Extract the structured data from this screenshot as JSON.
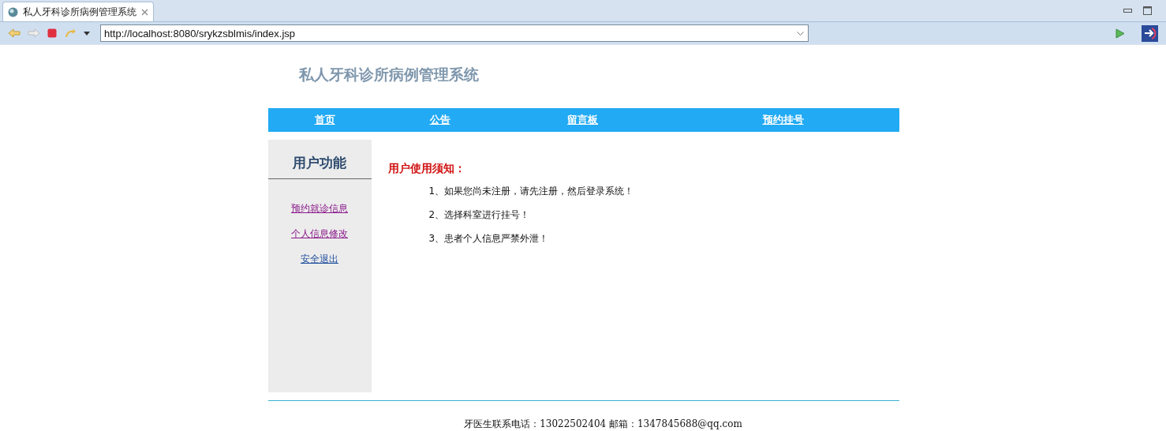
{
  "browser": {
    "tab_title": "私人牙科诊所病例管理系统",
    "url": "http://localhost:8080/srykzsblmis/index.jsp"
  },
  "site_title": "私人牙科诊所病例管理系统",
  "nav": [
    {
      "label": "首页"
    },
    {
      "label": "公告"
    },
    {
      "label": "留言板"
    },
    {
      "label": "预约挂号"
    }
  ],
  "sidebar": {
    "title": "用户功能",
    "links": [
      {
        "label": "预约就诊信息",
        "visited": true
      },
      {
        "label": "个人信息修改",
        "visited": true
      },
      {
        "label": "安全退出",
        "visited": false
      }
    ]
  },
  "notice": {
    "title": "用户使用须知：",
    "items": [
      "1、如果您尚未注册，请先注册，然后登录系统！",
      "2、选择科室进行挂号！",
      "3、患者个人信息严禁外泄！"
    ]
  },
  "footer": "牙医生联系电话：13022502404 邮箱：1347845688@qq.com"
}
